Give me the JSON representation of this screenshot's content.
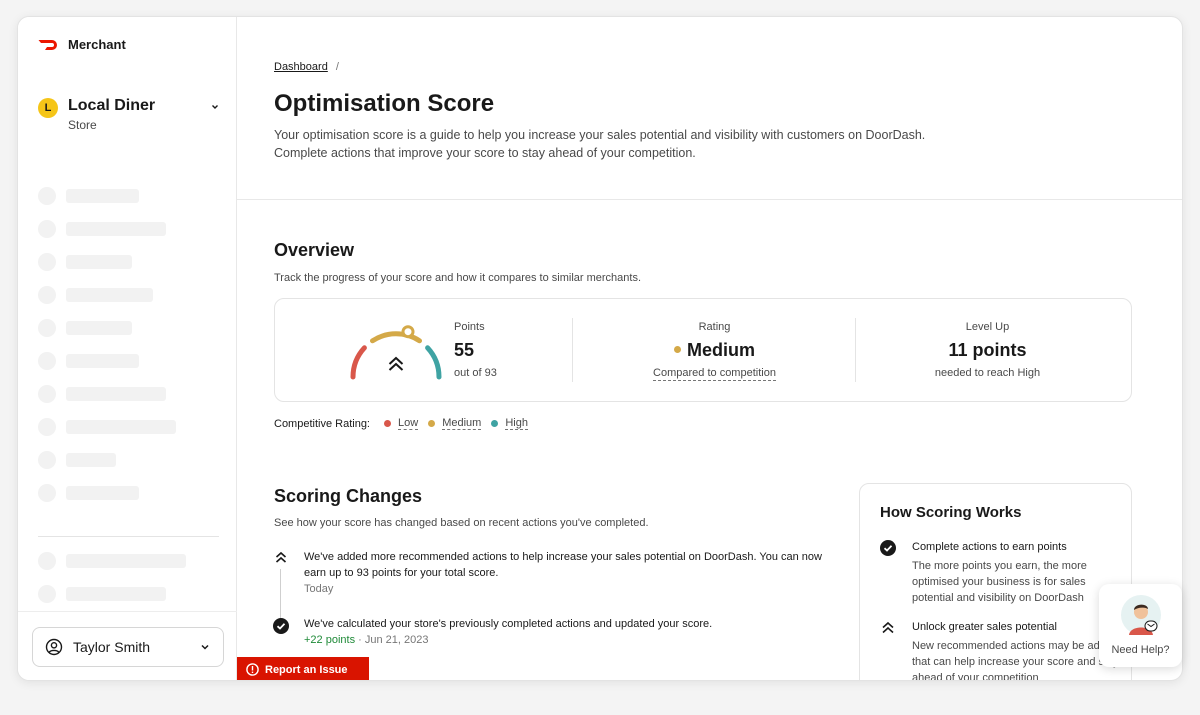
{
  "sidebar": {
    "brand": "Merchant",
    "store": {
      "initial": "L",
      "name": "Local Diner",
      "type": "Store"
    },
    "user": {
      "name": "Taylor Smith"
    }
  },
  "header": {
    "breadcrumb": "Dashboard",
    "title": "Optimisation Score",
    "description_line1": "Your optimisation score is a guide to help you increase your sales potential and visibility with customers on DoorDash.",
    "description_line2": "Complete actions that improve your score to stay ahead of your competition."
  },
  "overview": {
    "title": "Overview",
    "subtitle": "Track the progress of your score and how it compares to similar merchants.",
    "points": {
      "label": "Points",
      "value": "55",
      "sub": "out of 93",
      "score_fraction": 0.59
    },
    "rating": {
      "label": "Rating",
      "value": "Medium",
      "sub": "Compared to competition"
    },
    "level_up": {
      "label": "Level Up",
      "value": "11 points",
      "sub": "needed to reach High"
    },
    "legend": {
      "label": "Competitive Rating:",
      "items": [
        {
          "label": "Low",
          "color": "#d9574a"
        },
        {
          "label": "Medium",
          "color": "#d4a948"
        },
        {
          "label": "High",
          "color": "#3fa3a3"
        }
      ]
    }
  },
  "scoring_changes": {
    "title": "Scoring Changes",
    "subtitle": "See how your score has changed based on recent actions you've completed.",
    "items": [
      {
        "text": "We've added more recommended actions to help increase your sales potential on DoorDash. You can now earn up to 93 points for your total score.",
        "meta": "Today"
      },
      {
        "text": "We've calculated your store's previously completed actions and updated your score.",
        "points": "+22 points",
        "date": "Jun 21, 2023"
      }
    ]
  },
  "how_scoring": {
    "title": "How Scoring Works",
    "items": [
      {
        "title": "Complete actions to earn points",
        "text": "The more points you earn, the more optimised your business is for sales potential and visibility on DoorDash"
      },
      {
        "title": "Unlock greater sales potential",
        "text": "New recommended actions may be added that can help increase your score and stay ahead of your competition"
      }
    ]
  },
  "report_button": "Report an Issue",
  "help": "Need Help?",
  "colors": {
    "brand": "#eb1700",
    "report": "#d91400",
    "store_avatar": "#f5c518",
    "positive": "#1f8a38"
  }
}
